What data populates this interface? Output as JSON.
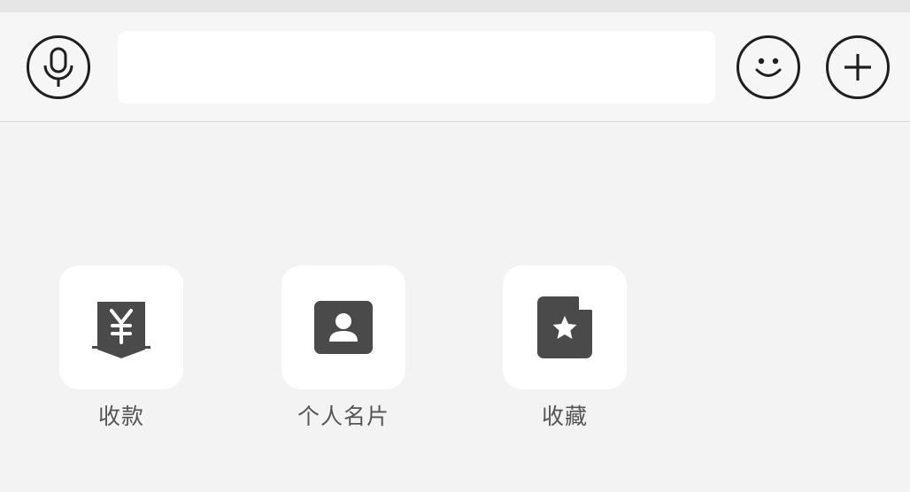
{
  "input_bar": {
    "voice_icon": "microphone-icon",
    "emoji_icon": "smiley-face-icon",
    "plus_icon": "plus-icon",
    "text_value": ""
  },
  "actions": [
    {
      "label": "收款",
      "icon": "yen-receipt-icon"
    },
    {
      "label": "个人名片",
      "icon": "contact-card-icon"
    },
    {
      "label": "收藏",
      "icon": "star-file-icon"
    }
  ],
  "colors": {
    "background": "#f3f3f3",
    "tile": "#ffffff",
    "icon": "#4a4a4a",
    "label": "#555555"
  }
}
